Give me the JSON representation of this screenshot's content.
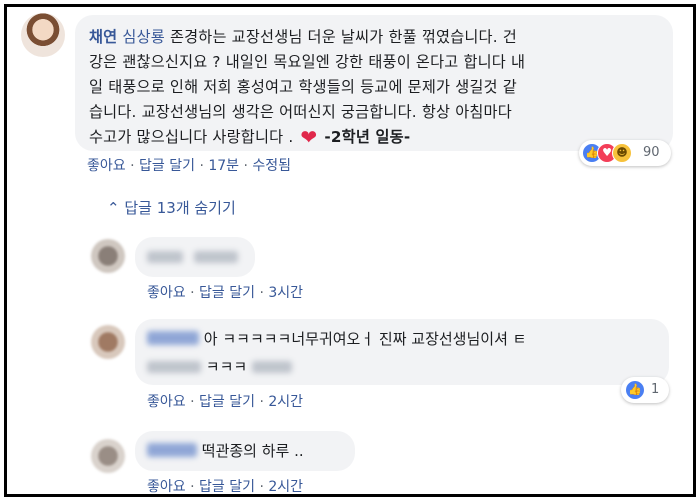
{
  "main_comment": {
    "author": "채연",
    "tagged_user": "심상룡",
    "text_lines": [
      "존경하는 교장선생님 더운 날씨가 한풀 꺾였습니다. 건",
      "강은 괜찮으신지요 ? 내일인 목요일엔 강한 태풍이 온다고 합니다 내",
      "일 태풍으로 인해 저희 홍성여고 학생들의 등교에 문제가 생길것 같",
      "습니다. 교장선생님의 생각은 어떠신지 궁금합니다. 항상 아침마다",
      "수고가 많으십니다 사랑합니다 ."
    ],
    "heart": "❤",
    "signature": "-2학년 일동-",
    "reaction_count": "90",
    "actions": {
      "like": "좋아요",
      "reply": "답글 달기",
      "time": "17분",
      "edited": "수정됨"
    }
  },
  "hide_replies": {
    "chevron": "⌃",
    "label": "답글 13개 숨기기"
  },
  "replies": [
    {
      "text": "",
      "actions": {
        "like": "좋아요",
        "reply": "답글 달기",
        "time": "3시간"
      }
    },
    {
      "text_line1": "아 ㅋㅋㅋㅋㅋ너무귀여오ㅓ 진짜 교장선생님이셔 ㅌ",
      "text_line2": "ㅋㅋㅋ",
      "reaction_count": "1",
      "actions": {
        "like": "좋아요",
        "reply": "답글 달기",
        "time": "2시간"
      }
    },
    {
      "text": "떡관종의 하루 ..",
      "actions": {
        "like": "좋아요",
        "reply": "답글 달기",
        "time": "2시간"
      }
    }
  ],
  "separator": "·",
  "colors": {
    "link": "#385898",
    "bubble": "#f2f3f5",
    "meta": "#606770",
    "like": "#4a7ff2",
    "love": "#f33e58",
    "haha": "#f7c23b"
  }
}
